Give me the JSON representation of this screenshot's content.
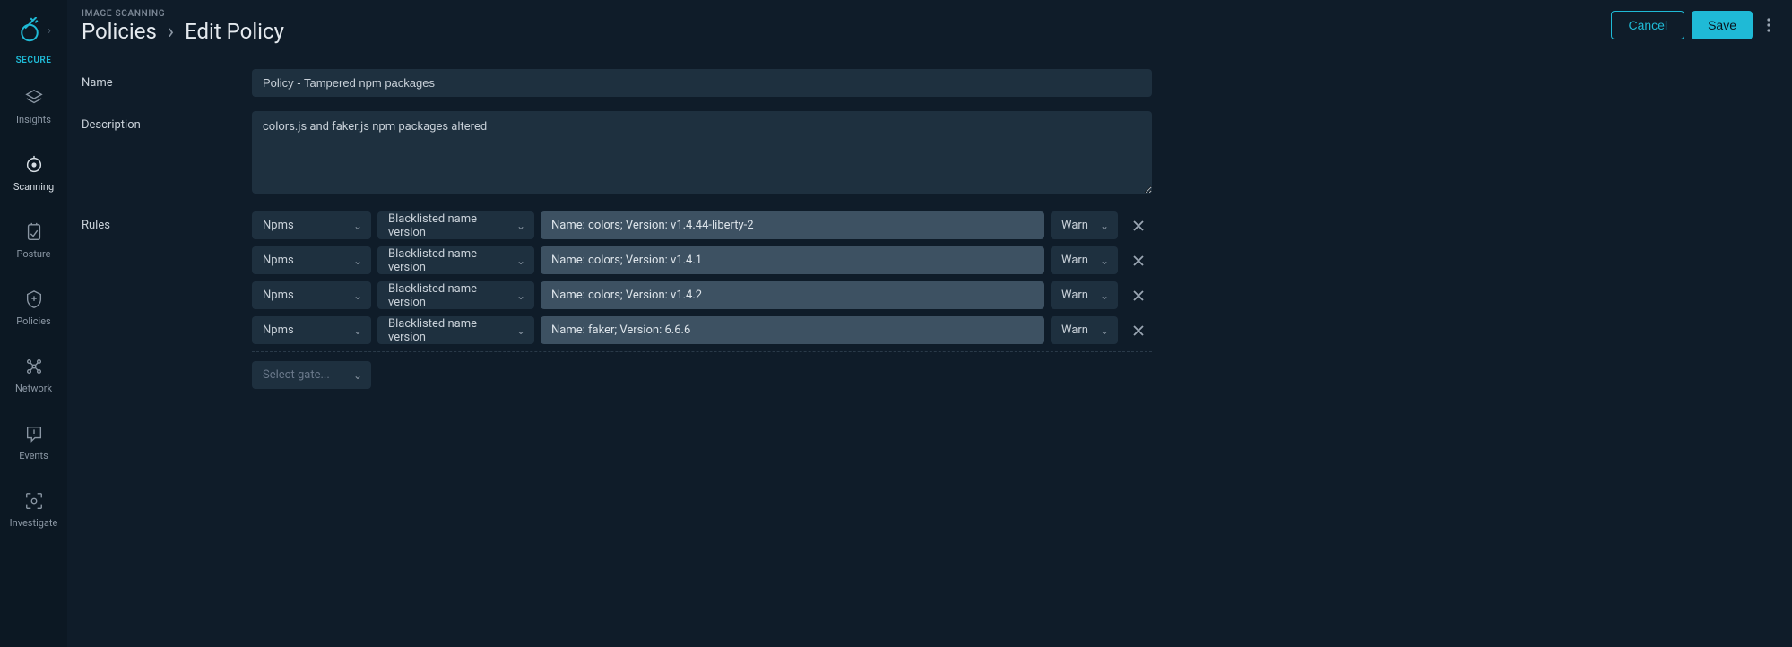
{
  "brand": "SECURE",
  "nav": [
    {
      "label": "Insights",
      "icon": "insights"
    },
    {
      "label": "Scanning",
      "icon": "scanning"
    },
    {
      "label": "Posture",
      "icon": "posture"
    },
    {
      "label": "Policies",
      "icon": "policies"
    },
    {
      "label": "Network",
      "icon": "network"
    },
    {
      "label": "Events",
      "icon": "events"
    },
    {
      "label": "Investigate",
      "icon": "investigate"
    }
  ],
  "header": {
    "section": "IMAGE SCANNING",
    "breadcrumb": [
      "Policies",
      "Edit Policy"
    ],
    "cancel": "Cancel",
    "save": "Save"
  },
  "form": {
    "labels": {
      "name": "Name",
      "description": "Description",
      "rules": "Rules"
    },
    "name": "Policy - Tampered npm packages",
    "description": "colors.js and faker.js npm packages altered",
    "addGatePlaceholder": "Select gate..."
  },
  "rules": [
    {
      "gate": "Npms",
      "trigger": "Blacklisted name version",
      "value": "Name: colors; Version: v1.4.44-liberty-2",
      "action": "Warn"
    },
    {
      "gate": "Npms",
      "trigger": "Blacklisted name version",
      "value": "Name: colors; Version: v1.4.1",
      "action": "Warn"
    },
    {
      "gate": "Npms",
      "trigger": "Blacklisted name version",
      "value": "Name: colors; Version: v1.4.2",
      "action": "Warn"
    },
    {
      "gate": "Npms",
      "trigger": "Blacklisted name version",
      "value": "Name: faker; Version: 6.6.6",
      "action": "Warn"
    }
  ]
}
